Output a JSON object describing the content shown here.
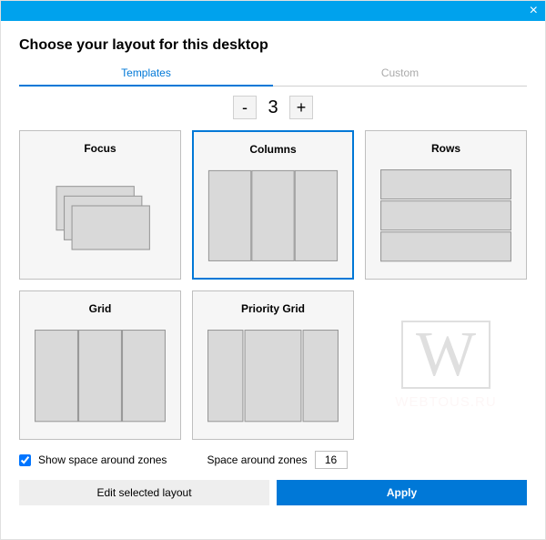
{
  "titlebar": {
    "close_glyph": "×"
  },
  "heading": "Choose your layout for this desktop",
  "tabs": {
    "templates": "Templates",
    "custom": "Custom"
  },
  "stepper": {
    "minus": "-",
    "plus": "+",
    "value": "3"
  },
  "cards": {
    "focus": "Focus",
    "columns": "Columns",
    "rows": "Rows",
    "grid": "Grid",
    "priority_grid": "Priority Grid"
  },
  "options": {
    "show_space_label": "Show space around zones",
    "space_label": "Space around zones",
    "space_value": "16"
  },
  "footer": {
    "edit": "Edit selected layout",
    "apply": "Apply"
  },
  "watermark": {
    "letter": "W",
    "text": "WEBTOUS.RU"
  },
  "colors": {
    "accent": "#0078d7",
    "titlebar": "#00a2ed"
  }
}
